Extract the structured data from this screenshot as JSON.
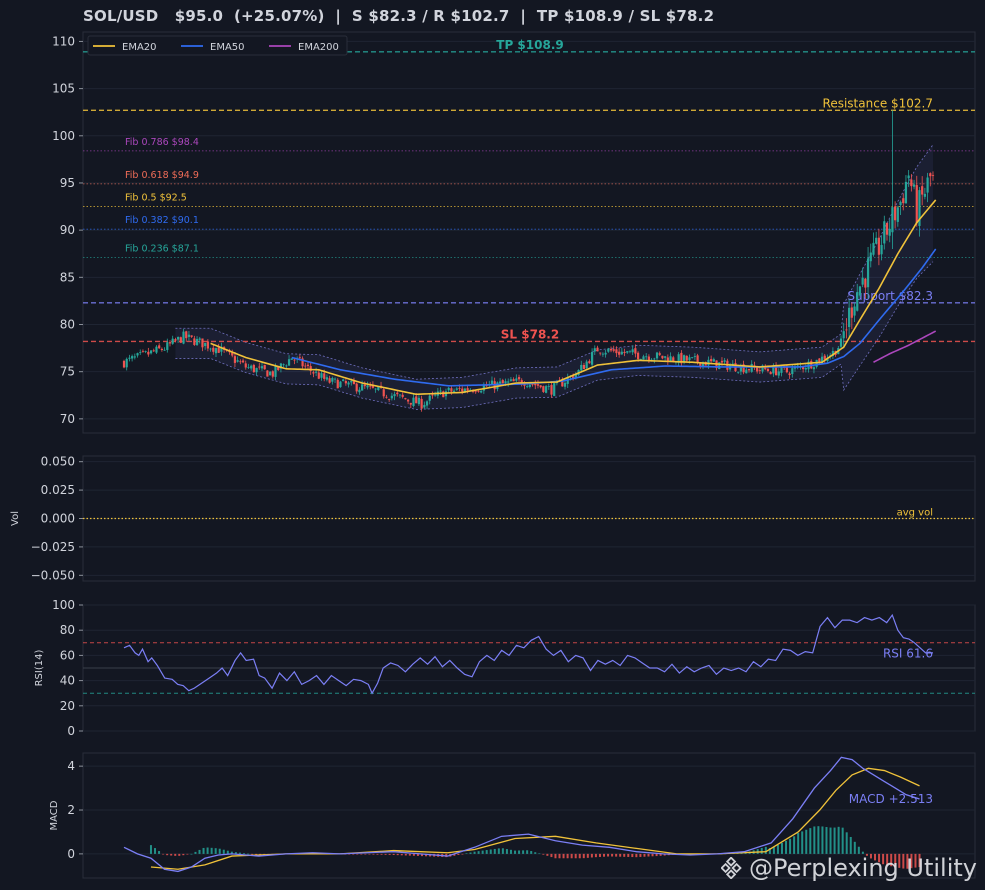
{
  "title": "SOL/USD   $95.0  (+25.07%)  |  S $82.3 / R $102.7  |  TP $108.9 / SL $78.2",
  "watermark": "@Perplexing Utility",
  "colors": {
    "background": "#131722",
    "panel": "#131722",
    "grid": "#1f2533",
    "border": "#2a2e39",
    "up": "#26a69a",
    "down": "#ef5350",
    "ema20": "#f0c23a",
    "ema50": "#2f6bf0",
    "ema200": "#ab47bc",
    "tp": "#26a69a",
    "sl": "#ef5350",
    "resistance": "#f0c23a",
    "support": "#7b7ff5",
    "rsi": "#7b7ff5",
    "macd": "#7b7ff5",
    "signal": "#f0c23a"
  },
  "chart_data": [
    {
      "type": "candlestick",
      "title": "SOL/USD   $95.0  (+25.07%)  |  S $82.3 / R $102.7  |  TP $108.9 / SL $78.2",
      "ylim": [
        68.5,
        111
      ],
      "yticks": [
        70,
        75,
        80,
        85,
        90,
        95,
        100,
        105,
        110
      ],
      "grid": true,
      "legend": {
        "position": "top-left",
        "entries": [
          "EMA20",
          "EMA50",
          "EMA200"
        ]
      },
      "n_candles": 300,
      "price_path": [
        [
          0,
          76.0
        ],
        [
          15,
          77.5
        ],
        [
          22,
          78.7
        ],
        [
          35,
          77.4
        ],
        [
          45,
          75.5
        ],
        [
          55,
          74.8
        ],
        [
          62,
          76.5
        ],
        [
          75,
          74.0
        ],
        [
          90,
          73.2
        ],
        [
          110,
          71.6
        ],
        [
          118,
          72.8
        ],
        [
          135,
          73.5
        ],
        [
          148,
          74.0
        ],
        [
          158,
          73.1
        ],
        [
          168,
          75.0
        ],
        [
          175,
          77.4
        ],
        [
          185,
          77.0
        ],
        [
          200,
          76.5
        ],
        [
          215,
          76.0
        ],
        [
          230,
          75.4
        ],
        [
          245,
          75.0
        ],
        [
          255,
          76.0
        ],
        [
          262,
          77.0
        ],
        [
          265,
          78.0
        ],
        [
          270,
          83.0
        ],
        [
          276,
          86.5
        ],
        [
          282,
          90.0
        ],
        [
          287,
          93.0
        ],
        [
          290,
          96.0
        ],
        [
          293,
          92.0
        ],
        [
          298,
          95.5
        ],
        [
          300,
          95.0
        ]
      ],
      "ema20_path": [
        [
          32,
          78.0
        ],
        [
          45,
          76.5
        ],
        [
          60,
          75.3
        ],
        [
          72,
          75.2
        ],
        [
          88,
          73.8
        ],
        [
          108,
          72.6
        ],
        [
          125,
          72.8
        ],
        [
          145,
          73.8
        ],
        [
          160,
          73.9
        ],
        [
          175,
          75.7
        ],
        [
          190,
          76.2
        ],
        [
          210,
          76.0
        ],
        [
          235,
          75.5
        ],
        [
          258,
          76.0
        ],
        [
          266,
          77.6
        ],
        [
          272,
          80.5
        ],
        [
          279,
          83.8
        ],
        [
          286,
          87.5
        ],
        [
          293,
          90.8
        ],
        [
          300,
          93.2
        ]
      ],
      "ema50_path": [
        [
          62,
          76.5
        ],
        [
          80,
          75.2
        ],
        [
          100,
          74.2
        ],
        [
          120,
          73.5
        ],
        [
          148,
          73.7
        ],
        [
          162,
          74.0
        ],
        [
          180,
          75.2
        ],
        [
          200,
          75.6
        ],
        [
          222,
          75.5
        ],
        [
          250,
          75.5
        ],
        [
          260,
          75.9
        ],
        [
          266,
          76.6
        ],
        [
          272,
          78.0
        ],
        [
          280,
          80.8
        ],
        [
          288,
          83.5
        ],
        [
          295,
          86.0
        ],
        [
          300,
          88.0
        ]
      ],
      "ema200_path": [
        [
          277,
          76.0
        ],
        [
          283,
          76.9
        ],
        [
          290,
          77.8
        ],
        [
          300,
          79.3
        ]
      ],
      "levels": [
        {
          "name": "TP",
          "label": "TP $108.9",
          "value": 108.9,
          "color": "#26a69a",
          "style": "dashed",
          "label_pos": "center"
        },
        {
          "name": "Resistance",
          "label": "Resistance $102.7",
          "value": 102.7,
          "color": "#f0c23a",
          "style": "dashed",
          "label_pos": "right"
        },
        {
          "name": "Support",
          "label": "Support $82.3",
          "value": 82.3,
          "color": "#7b7ff5",
          "style": "dashed",
          "label_pos": "right"
        },
        {
          "name": "SL",
          "label": "SL $78.2",
          "value": 78.2,
          "color": "#ef5350",
          "style": "dashed",
          "label_pos": "center"
        }
      ],
      "fib_levels": [
        {
          "label": "Fib 0.786 $98.4",
          "value": 98.4,
          "color": "#ab47bc"
        },
        {
          "label": "Fib 0.618 $94.9",
          "value": 94.9,
          "color": "#ef6c57"
        },
        {
          "label": "Fib 0.5 $92.5",
          "value": 92.5,
          "color": "#f0c23a"
        },
        {
          "label": "Fib 0.382 $90.1",
          "value": 90.1,
          "color": "#2f6bf0"
        },
        {
          "label": "Fib 0.236 $87.1",
          "value": 87.1,
          "color": "#26a69a"
        }
      ],
      "bollinger_bands": true
    },
    {
      "type": "bar",
      "ylabel": "Vol",
      "ylim": [
        -0.055,
        0.055
      ],
      "yticks": [
        0.05,
        0.025,
        0.0,
        -0.025,
        -0.05
      ],
      "ytick_labels": [
        "0.050",
        "0.025",
        "0.000",
        "−0.025",
        "−0.050"
      ],
      "reference": {
        "label": "avg vol",
        "value": 0.0,
        "color": "#f0c23a"
      },
      "values": []
    },
    {
      "type": "line",
      "ylabel": "RSI(14)",
      "ylim": [
        0,
        100
      ],
      "yticks": [
        0,
        20,
        40,
        60,
        80,
        100
      ],
      "overbought": 70,
      "oversold": 30,
      "last_label": "RSI 61.6",
      "path": [
        [
          0,
          66
        ],
        [
          3,
          68
        ],
        [
          6,
          62
        ],
        [
          8,
          60
        ],
        [
          10,
          65
        ],
        [
          13,
          55
        ],
        [
          15,
          58
        ],
        [
          18,
          52
        ],
        [
          22,
          42
        ],
        [
          26,
          41
        ],
        [
          29,
          37
        ],
        [
          32,
          36
        ],
        [
          35,
          32
        ],
        [
          38,
          34
        ],
        [
          42,
          38
        ],
        [
          46,
          42
        ],
        [
          50,
          46
        ],
        [
          53,
          50
        ],
        [
          56,
          44
        ],
        [
          60,
          56
        ],
        [
          63,
          62
        ],
        [
          66,
          56
        ],
        [
          70,
          57
        ],
        [
          73,
          44
        ],
        [
          76,
          42
        ],
        [
          80,
          34
        ],
        [
          84,
          46
        ],
        [
          88,
          40
        ],
        [
          92,
          47
        ],
        [
          96,
          37
        ],
        [
          100,
          40
        ],
        [
          104,
          44
        ],
        [
          108,
          37
        ],
        [
          112,
          44
        ],
        [
          116,
          40
        ],
        [
          120,
          36
        ],
        [
          124,
          41
        ],
        [
          128,
          40
        ],
        [
          132,
          37
        ],
        [
          134,
          30
        ],
        [
          137,
          38
        ],
        [
          140,
          50
        ],
        [
          144,
          54
        ],
        [
          148,
          52
        ],
        [
          152,
          47
        ],
        [
          156,
          53
        ],
        [
          160,
          58
        ],
        [
          164,
          53
        ],
        [
          168,
          59
        ],
        [
          172,
          51
        ],
        [
          176,
          56
        ],
        [
          180,
          50
        ],
        [
          184,
          45
        ],
        [
          188,
          43
        ],
        [
          192,
          55
        ],
        [
          196,
          60
        ],
        [
          200,
          56
        ],
        [
          204,
          64
        ],
        [
          208,
          60
        ],
        [
          212,
          68
        ],
        [
          216,
          66
        ],
        [
          220,
          72
        ],
        [
          224,
          75
        ],
        [
          228,
          65
        ],
        [
          232,
          60
        ],
        [
          236,
          64
        ],
        [
          240,
          55
        ],
        [
          244,
          60
        ],
        [
          248,
          58
        ],
        [
          252,
          48
        ],
        [
          256,
          56
        ],
        [
          260,
          53
        ],
        [
          264,
          56
        ],
        [
          268,
          52
        ],
        [
          272,
          60
        ],
        [
          276,
          58
        ],
        [
          280,
          54
        ],
        [
          284,
          50
        ],
        [
          288,
          50
        ],
        [
          292,
          47
        ],
        [
          296,
          53
        ],
        [
          300,
          46
        ],
        [
          304,
          51
        ],
        [
          308,
          47
        ],
        [
          312,
          50
        ],
        [
          316,
          52
        ],
        [
          320,
          45
        ],
        [
          324,
          50
        ],
        [
          328,
          48
        ],
        [
          332,
          50
        ],
        [
          336,
          47
        ],
        [
          340,
          55
        ],
        [
          344,
          51
        ],
        [
          348,
          57
        ],
        [
          352,
          56
        ],
        [
          356,
          65
        ],
        [
          360,
          64
        ],
        [
          364,
          60
        ],
        [
          368,
          63
        ],
        [
          372,
          62
        ],
        [
          376,
          83
        ],
        [
          380,
          90
        ],
        [
          384,
          82
        ],
        [
          388,
          88
        ],
        [
          392,
          88
        ],
        [
          396,
          86
        ],
        [
          400,
          90
        ],
        [
          404,
          88
        ],
        [
          408,
          90
        ],
        [
          412,
          86
        ],
        [
          415,
          92
        ],
        [
          418,
          80
        ],
        [
          421,
          74
        ],
        [
          424,
          73
        ],
        [
          427,
          70
        ],
        [
          430,
          66
        ],
        [
          433,
          62
        ],
        [
          437,
          62
        ]
      ],
      "x_domain": [
        0,
        437
      ]
    },
    {
      "type": "bar+line",
      "ylabel": "MACD",
      "ylim": [
        -1.1,
        4.6
      ],
      "yticks": [
        0,
        2,
        4
      ],
      "last_label": "MACD +2.513",
      "macd_path": [
        [
          0,
          0.3
        ],
        [
          5,
          0.0
        ],
        [
          10,
          -0.2
        ],
        [
          15,
          -0.7
        ],
        [
          20,
          -0.8
        ],
        [
          25,
          -0.6
        ],
        [
          30,
          -0.2
        ],
        [
          35,
          -0.05
        ],
        [
          40,
          0.0
        ],
        [
          50,
          -0.1
        ],
        [
          60,
          0.0
        ],
        [
          70,
          0.05
        ],
        [
          80,
          0.0
        ],
        [
          90,
          0.05
        ],
        [
          100,
          0.1
        ],
        [
          110,
          0.0
        ],
        [
          120,
          -0.1
        ],
        [
          130,
          0.3
        ],
        [
          140,
          0.8
        ],
        [
          150,
          0.9
        ],
        [
          160,
          0.6
        ],
        [
          170,
          0.4
        ],
        [
          180,
          0.3
        ],
        [
          190,
          0.1
        ],
        [
          200,
          0.0
        ],
        [
          210,
          -0.05
        ],
        [
          220,
          0.0
        ],
        [
          230,
          0.1
        ],
        [
          240,
          0.5
        ],
        [
          248,
          1.6
        ],
        [
          256,
          3.0
        ],
        [
          262,
          3.8
        ],
        [
          266,
          4.4
        ],
        [
          270,
          4.3
        ],
        [
          274,
          3.9
        ],
        [
          278,
          3.6
        ],
        [
          282,
          3.3
        ],
        [
          286,
          3.0
        ],
        [
          290,
          2.7
        ],
        [
          295,
          2.5
        ]
      ],
      "signal_path": [
        [
          10,
          -0.6
        ],
        [
          20,
          -0.7
        ],
        [
          30,
          -0.5
        ],
        [
          40,
          -0.1
        ],
        [
          50,
          -0.05
        ],
        [
          60,
          0.0
        ],
        [
          80,
          0.0
        ],
        [
          100,
          0.15
        ],
        [
          110,
          0.1
        ],
        [
          120,
          0.05
        ],
        [
          130,
          0.2
        ],
        [
          145,
          0.7
        ],
        [
          160,
          0.8
        ],
        [
          175,
          0.5
        ],
        [
          190,
          0.25
        ],
        [
          205,
          0.0
        ],
        [
          220,
          0.0
        ],
        [
          238,
          0.1
        ],
        [
          250,
          1.0
        ],
        [
          258,
          2.0
        ],
        [
          264,
          2.9
        ],
        [
          270,
          3.6
        ],
        [
          276,
          3.9
        ],
        [
          282,
          3.8
        ],
        [
          288,
          3.5
        ],
        [
          295,
          3.1
        ]
      ],
      "x_domain": [
        0,
        300
      ]
    }
  ]
}
